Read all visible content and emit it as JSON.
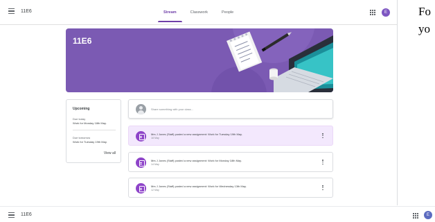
{
  "header": {
    "class_name": "11E6",
    "tabs": [
      "Stream",
      "Classwork",
      "People"
    ],
    "active_tab": "Stream",
    "avatar_letter": "E"
  },
  "banner": {
    "title": "11E6"
  },
  "upcoming": {
    "title": "Upcoming",
    "items": [
      {
        "due": "Due today",
        "work": "Work for Monday 18th May."
      },
      {
        "due": "Due tomorrow",
        "work": "Work for Tuesday 19th May."
      }
    ],
    "view_all": "View all"
  },
  "share": {
    "placeholder": "Share something with your class..."
  },
  "posts": [
    {
      "title": "Mrs J Jones (Staff) posted a new assignment: Work for Tuesday 19th May.",
      "date": "18 May"
    },
    {
      "title": "Mrs J Jones (Staff) posted a new assignment: Work for Monday 18th May.",
      "date": "14 May"
    },
    {
      "title": "Mrs J Jones (Staff) posted a new assignment: Work for Wednesday 13th May.",
      "date": "12 May"
    }
  ],
  "side_text": [
    "Fo",
    "yo"
  ],
  "bottom_bar": {
    "class_name": "11E6",
    "avatar_letter": "E"
  },
  "colors": {
    "accent": "#6f3fa8",
    "banner": "#7b5ab3",
    "assignment_icon": "#8e44c9",
    "highlight_row": "#f3e8fd"
  }
}
